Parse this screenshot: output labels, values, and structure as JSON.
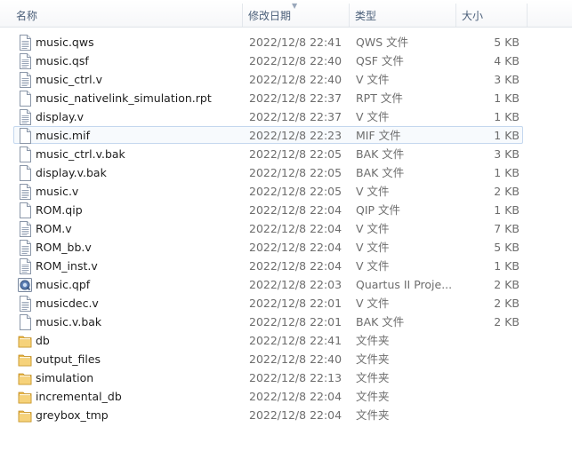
{
  "columns": {
    "name": "名称",
    "date": "修改日期",
    "type": "类型",
    "size": "大小"
  },
  "files": [
    {
      "name": "music.qws",
      "date": "2022/12/8 22:41",
      "type": "QWS 文件",
      "size": "5 KB",
      "icon": "text-file-icon"
    },
    {
      "name": "music.qsf",
      "date": "2022/12/8 22:40",
      "type": "QSF 文件",
      "size": "4 KB",
      "icon": "text-file-icon"
    },
    {
      "name": "music_ctrl.v",
      "date": "2022/12/8 22:40",
      "type": "V 文件",
      "size": "3 KB",
      "icon": "text-file-icon"
    },
    {
      "name": "music_nativelink_simulation.rpt",
      "date": "2022/12/8 22:37",
      "type": "RPT 文件",
      "size": "1 KB",
      "icon": "blank-file-icon"
    },
    {
      "name": "display.v",
      "date": "2022/12/8 22:37",
      "type": "V 文件",
      "size": "1 KB",
      "icon": "text-file-icon"
    },
    {
      "name": "music.mif",
      "date": "2022/12/8 22:23",
      "type": "MIF 文件",
      "size": "1 KB",
      "icon": "blank-file-icon",
      "selected": true
    },
    {
      "name": "music_ctrl.v.bak",
      "date": "2022/12/8 22:05",
      "type": "BAK 文件",
      "size": "3 KB",
      "icon": "blank-file-icon"
    },
    {
      "name": "display.v.bak",
      "date": "2022/12/8 22:05",
      "type": "BAK 文件",
      "size": "1 KB",
      "icon": "blank-file-icon"
    },
    {
      "name": "music.v",
      "date": "2022/12/8 22:05",
      "type": "V 文件",
      "size": "2 KB",
      "icon": "text-file-icon"
    },
    {
      "name": "ROM.qip",
      "date": "2022/12/8 22:04",
      "type": "QIP 文件",
      "size": "1 KB",
      "icon": "blank-file-icon"
    },
    {
      "name": "ROM.v",
      "date": "2022/12/8 22:04",
      "type": "V 文件",
      "size": "7 KB",
      "icon": "text-file-icon"
    },
    {
      "name": "ROM_bb.v",
      "date": "2022/12/8 22:04",
      "type": "V 文件",
      "size": "5 KB",
      "icon": "text-file-icon"
    },
    {
      "name": "ROM_inst.v",
      "date": "2022/12/8 22:04",
      "type": "V 文件",
      "size": "1 KB",
      "icon": "text-file-icon"
    },
    {
      "name": "music.qpf",
      "date": "2022/12/8 22:03",
      "type": "Quartus II Proje...",
      "size": "2 KB",
      "icon": "quartus-project-icon"
    },
    {
      "name": "musicdec.v",
      "date": "2022/12/8 22:01",
      "type": "V 文件",
      "size": "2 KB",
      "icon": "text-file-icon"
    },
    {
      "name": "music.v.bak",
      "date": "2022/12/8 22:01",
      "type": "BAK 文件",
      "size": "2 KB",
      "icon": "blank-file-icon"
    },
    {
      "name": "db",
      "date": "2022/12/8 22:41",
      "type": "文件夹",
      "size": "",
      "icon": "folder-icon"
    },
    {
      "name": "output_files",
      "date": "2022/12/8 22:40",
      "type": "文件夹",
      "size": "",
      "icon": "folder-icon"
    },
    {
      "name": "simulation",
      "date": "2022/12/8 22:13",
      "type": "文件夹",
      "size": "",
      "icon": "folder-icon"
    },
    {
      "name": "incremental_db",
      "date": "2022/12/8 22:04",
      "type": "文件夹",
      "size": "",
      "icon": "folder-icon"
    },
    {
      "name": "greybox_tmp",
      "date": "2022/12/8 22:04",
      "type": "文件夹",
      "size": "",
      "icon": "folder-icon"
    }
  ]
}
